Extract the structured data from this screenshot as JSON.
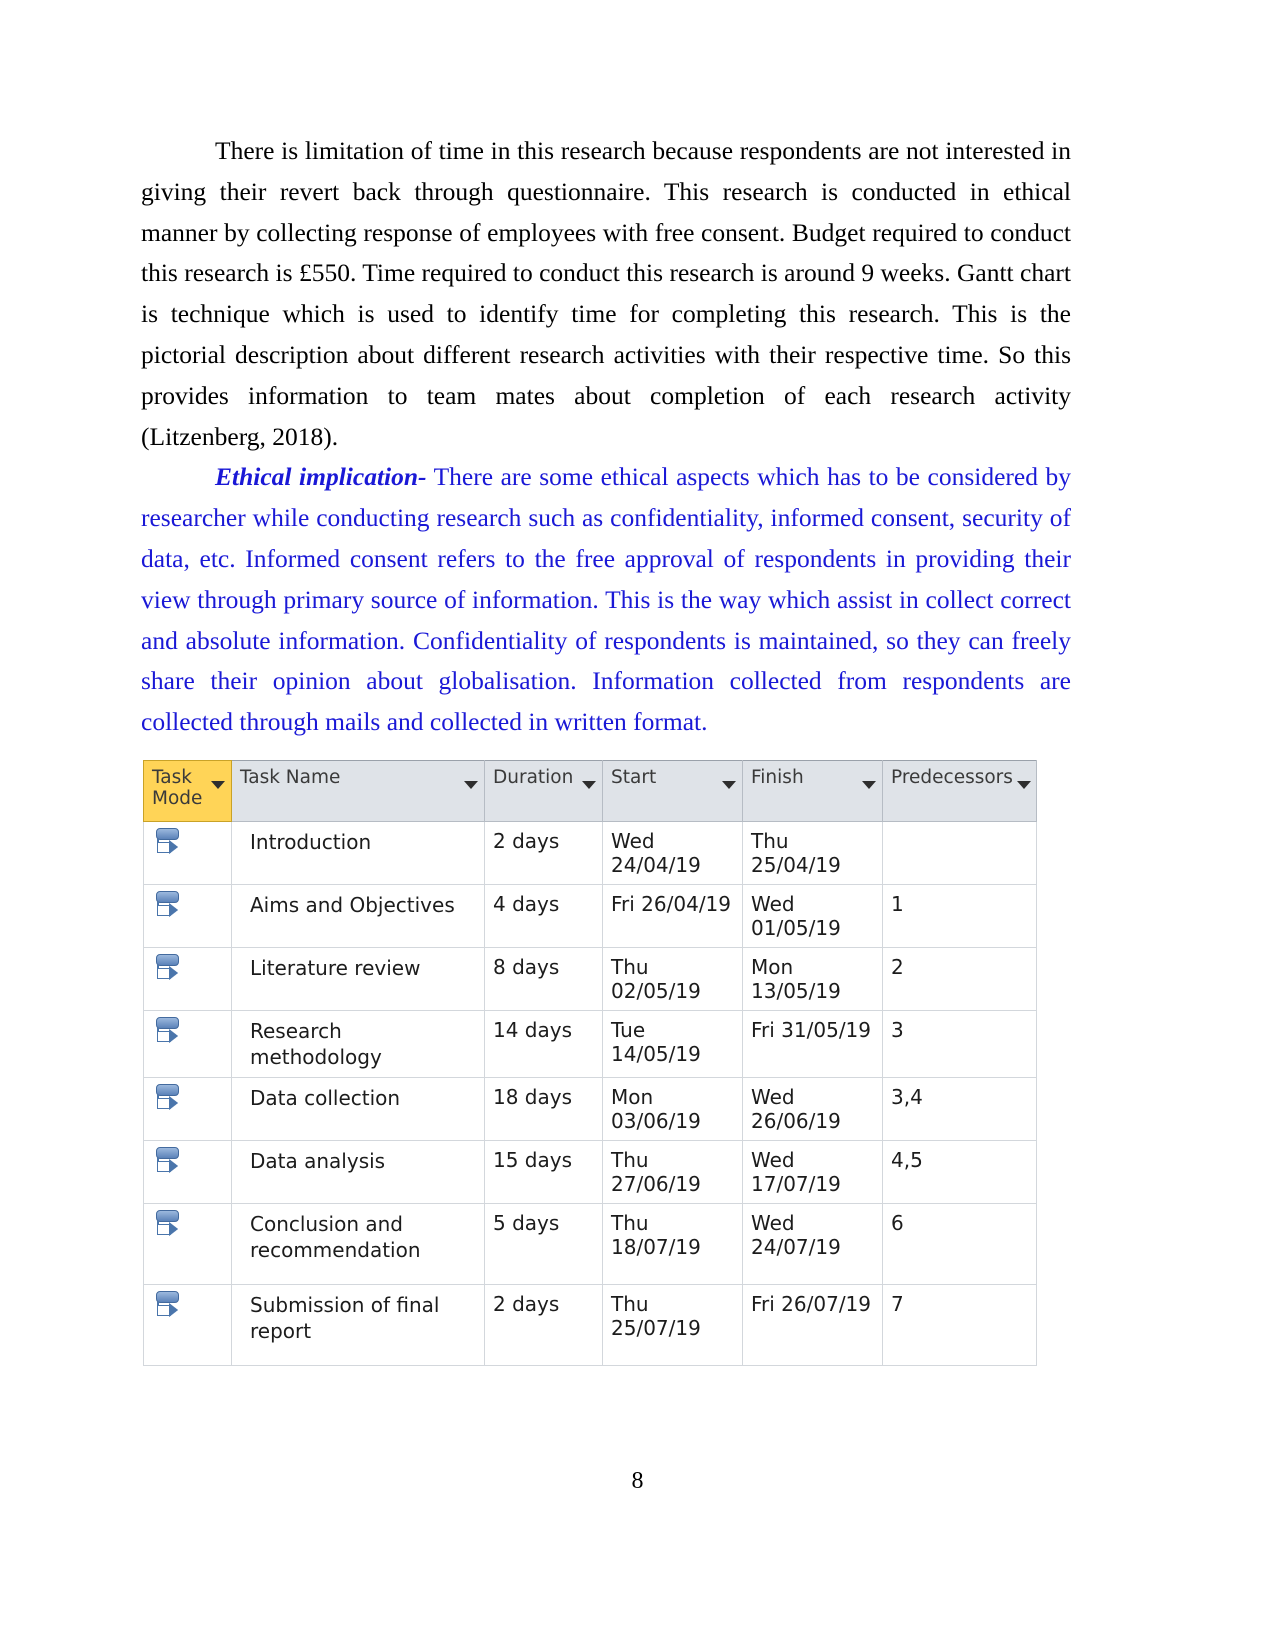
{
  "document": {
    "page_number": "8",
    "body_text_color": "#000000",
    "highlight_text_color": "#1a18d6",
    "paragraphs": [
      {
        "id": "para-limitation",
        "color": "#000000",
        "text": "There is limitation of time in this research because respondents are not interested in giving their revert back through questionnaire. This research is conducted in ethical manner by collecting response of employees with free consent. Budget required to conduct this research is £550. Time required to conduct this research is around 9 weeks. Gantt chart is technique which is used to identify time for completing this research. This is the pictorial description about different research activities with their respective time. So this provides information to team mates about completion of each research activity (Litzenberg, 2018)."
      },
      {
        "id": "para-ethical-implication",
        "color": "#1a18d6",
        "lead_in": "Ethical implication-",
        "text": " There are some ethical aspects which has to be considered by researcher while conducting research such as confidentiality, informed consent, security of data, etc. Informed consent refers to the free approval of respondents in providing their view through primary source of information. This is the way which assist in collect correct and absolute information. Confidentiality of respondents is maintained, so they can freely share their opinion about globalisation. Information collected from respondents are collected through mails and collected in written format."
      }
    ]
  },
  "gantt_table": {
    "header_accent_color": "#ffd457",
    "header_background_color": "#dfe3e8",
    "columns": [
      {
        "key": "task_mode",
        "label": "Task Mode",
        "accent": true,
        "filter": true
      },
      {
        "key": "task_name",
        "label": "Task Name",
        "accent": false,
        "filter": true
      },
      {
        "key": "duration",
        "label": "Duration",
        "accent": false,
        "filter": true
      },
      {
        "key": "start",
        "label": "Start",
        "accent": false,
        "filter": true
      },
      {
        "key": "finish",
        "label": "Finish",
        "accent": false,
        "filter": true
      },
      {
        "key": "predecessors",
        "label": "Predecessors",
        "accent": false,
        "filter": true
      }
    ],
    "rows": [
      {
        "mode_icon": "auto-scheduled-icon",
        "task_name": "Introduction",
        "duration": "2 days",
        "start": "Wed 24/04/19",
        "finish": "Thu 25/04/19",
        "predecessors": ""
      },
      {
        "mode_icon": "auto-scheduled-icon",
        "task_name": "Aims and Objectives",
        "duration": "4 days",
        "start": "Fri 26/04/19",
        "finish": "Wed 01/05/19",
        "predecessors": "1"
      },
      {
        "mode_icon": "auto-scheduled-icon",
        "task_name": "Literature review",
        "duration": "8 days",
        "start": "Thu 02/05/19",
        "finish": "Mon 13/05/19",
        "predecessors": "2"
      },
      {
        "mode_icon": "auto-scheduled-icon",
        "task_name": "Research methodology",
        "duration": "14 days",
        "start": "Tue 14/05/19",
        "finish": "Fri 31/05/19",
        "predecessors": "3"
      },
      {
        "mode_icon": "auto-scheduled-icon",
        "task_name": "Data collection",
        "duration": "18 days",
        "start": "Mon 03/06/19",
        "finish": "Wed 26/06/19",
        "predecessors": "3,4"
      },
      {
        "mode_icon": "auto-scheduled-icon",
        "task_name": "Data analysis",
        "duration": "15 days",
        "start": "Thu 27/06/19",
        "finish": "Wed 17/07/19",
        "predecessors": "4,5"
      },
      {
        "mode_icon": "auto-scheduled-icon",
        "task_name": "Conclusion and recommendation",
        "duration": "5 days",
        "start": "Thu 18/07/19",
        "finish": "Wed 24/07/19",
        "predecessors": "6"
      },
      {
        "mode_icon": "auto-scheduled-icon",
        "task_name": "Submission of final report",
        "duration": "2 days",
        "start": "Thu 25/07/19",
        "finish": "Fri 26/07/19",
        "predecessors": "7"
      }
    ]
  }
}
